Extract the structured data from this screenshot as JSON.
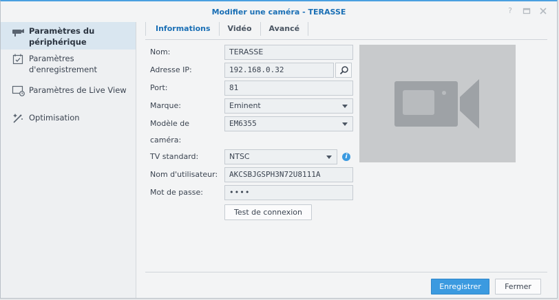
{
  "window": {
    "title": "Modifier une caméra - TERASSE",
    "controls": [
      "help-icon",
      "maximize-icon",
      "close-icon"
    ]
  },
  "sidebar": {
    "items": [
      {
        "label": "Paramètres du périphérique",
        "icon": "camera-icon",
        "active": true
      },
      {
        "label": "Paramètres d'enregistrement",
        "icon": "calendar-check-icon",
        "active": false
      },
      {
        "label": "Paramètres de Live View",
        "icon": "monitor-icon",
        "active": false
      },
      {
        "label": "Optimisation",
        "icon": "magic-wand-icon",
        "active": false
      }
    ]
  },
  "tabs": [
    {
      "label": "Informations",
      "active": true
    },
    {
      "label": "Vidéo",
      "active": false
    },
    {
      "label": "Avancé",
      "active": false
    }
  ],
  "form": {
    "name_label": "Nom:",
    "name_value": "TERASSE",
    "ip_label": "Adresse IP:",
    "ip_value": "192.168.0.32",
    "port_label": "Port:",
    "port_value": "81",
    "brand_label": "Marque:",
    "brand_value": "Eminent",
    "model_label_1": "Modèle de",
    "model_label_2": "caméra:",
    "model_value": "EM6355",
    "tv_label": "TV standard:",
    "tv_value": "NTSC",
    "user_label": "Nom d'utilisateur:",
    "user_value": "AKCSBJGSPH3N72U8111A",
    "password_label": "Mot de passe:",
    "password_value": "••••",
    "test_button": "Test de connexion"
  },
  "footer": {
    "save_button": "Enregistrer",
    "close_button": "Fermer"
  },
  "colors": {
    "accent": "#3b9ae0",
    "title": "#1a6fb5",
    "preview_bg": "#c8cacc",
    "preview_icon": "#9ea2a6"
  }
}
